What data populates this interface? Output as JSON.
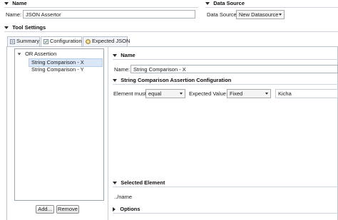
{
  "name_section": {
    "title": "Name",
    "name_label": "Name:",
    "name_value": "JSON Assertor"
  },
  "datasource_section": {
    "title": "Data Source",
    "label": "Data Source:",
    "selected": "New Datasource"
  },
  "tool_settings": {
    "title": "Tool Settings",
    "tabs": [
      {
        "label": "Summary"
      },
      {
        "label": "Configuration"
      },
      {
        "label": "Expected JSON"
      }
    ]
  },
  "tree": {
    "root": "OR Assertion",
    "children": [
      "String Comparison - X",
      "String Comparison - Y"
    ],
    "add_button": "Add...",
    "remove_button": "Remove"
  },
  "detail_name": {
    "title": "Name",
    "label": "Name:",
    "value": "String Comparison - X"
  },
  "config": {
    "title": "String Comparison Assertion Configuration",
    "element_must_label": "Element must",
    "element_must_value": "equal",
    "expected_value_label": "Expected Value:",
    "expected_value_mode": "Fixed",
    "expected_value_text": "Kicha"
  },
  "selected_element": {
    "title": "Selected Element",
    "value": "../name"
  },
  "options": {
    "title": "Options"
  },
  "colors": {
    "selection": "#dbe7f6",
    "border": "#b9c2cc"
  }
}
